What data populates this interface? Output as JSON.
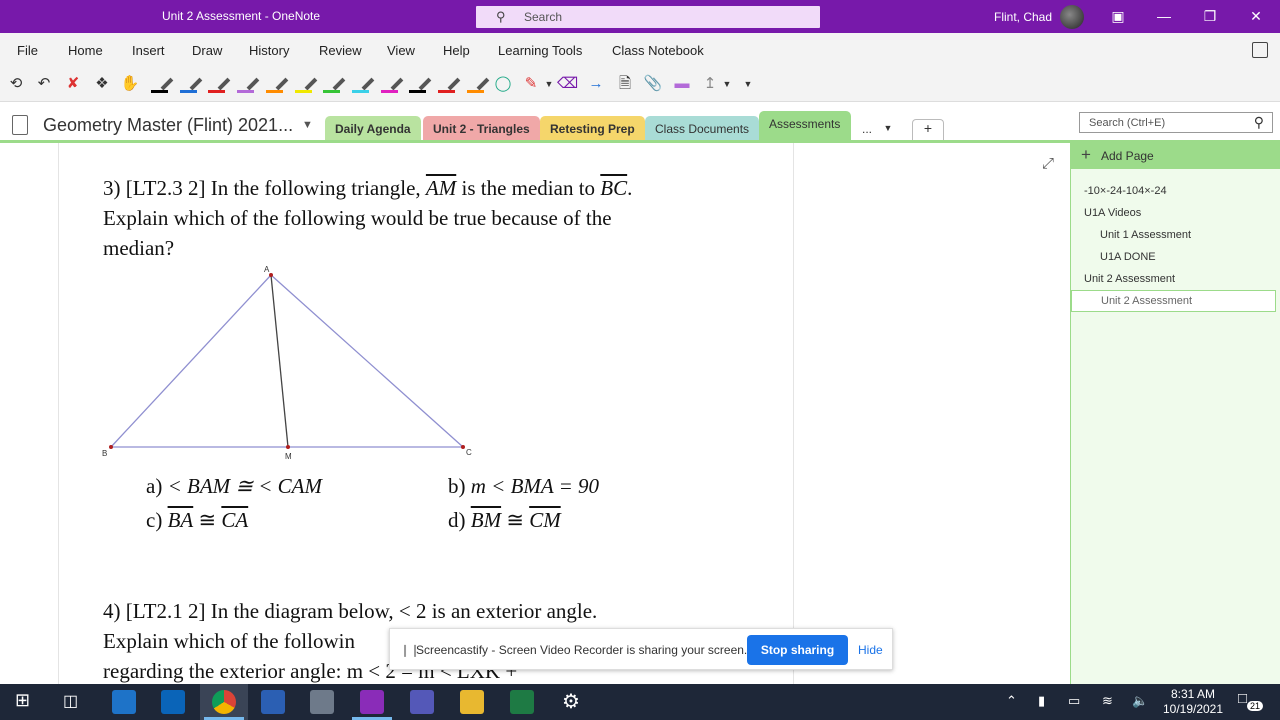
{
  "window": {
    "title": "Unit 2 Assessment  -  OneNote",
    "search_placeholder": "Search",
    "user": "Flint, Chad"
  },
  "menu": [
    "File",
    "Home",
    "Insert",
    "Draw",
    "History",
    "Review",
    "View",
    "Help",
    "Learning Tools",
    "Class Notebook"
  ],
  "pen_colors": [
    "#000000",
    "#1f6fd6",
    "#e02020",
    "#b36ad8",
    "#ff8c00",
    "#f0e800",
    "#36c436",
    "#3ad0e8",
    "#e020c0",
    "#000000",
    "#e02020",
    "#ff8c00"
  ],
  "notebook": {
    "name": "Geometry Master (Flint) 2021...",
    "tabs": [
      {
        "label": "Daily Agenda",
        "color": "#b9e3a0"
      },
      {
        "label": "Unit 2 - Triangles",
        "color": "#f0a8a8"
      },
      {
        "label": "Retesting Prep",
        "color": "#f5d66b"
      },
      {
        "label": "Class Documents",
        "color": "#a9dcd6"
      },
      {
        "label": "Assessments",
        "color": "#9cdb8a"
      }
    ],
    "more": "...",
    "add": "+",
    "search_placeholder": "Search (Ctrl+E)"
  },
  "question3": {
    "line1_pre": "3) [LT2.3 2] In the following triangle, ",
    "seg_am": "AM",
    "line1_mid": " is the median to ",
    "seg_bc": "BC",
    "line1_end": ".",
    "line2": "Explain which of the following would be true because of the",
    "line3": "median?",
    "vertex_labels": {
      "a": "A",
      "b": "B",
      "c": "C",
      "m": "M"
    },
    "choices": {
      "a_label": "a) ",
      "a_expr": "< BAM ≅ < CAM",
      "b_label": "b) ",
      "b_expr": "m < BMA = 90",
      "c_label": "c) ",
      "c_left": "BA",
      "c_rel": " ≅ ",
      "c_right": "CA",
      "d_label": "d) ",
      "d_left": "BM",
      "d_rel": " ≅ ",
      "d_right": "CM"
    }
  },
  "question4": {
    "line1": "4) [LT2.1 2] In the diagram below, < 2 is an exterior angle.",
    "line2": "Explain which of the followin",
    "line3": "regarding the exterior angle:  m < 2 = m < LXK + "
  },
  "sharing": {
    "message": "Screencastify - Screen Video Recorder is sharing your screen.",
    "stop": "Stop sharing",
    "hide": "Hide"
  },
  "pages": {
    "add_page": "Add Page",
    "items": [
      {
        "label": "-10×-24-104×-24",
        "indent": 0
      },
      {
        "label": "U1A Videos",
        "indent": 0
      },
      {
        "label": "Unit 1 Assessment",
        "indent": 1
      },
      {
        "label": "U1A DONE",
        "indent": 1
      },
      {
        "label": "Unit 2 Assessment",
        "indent": 0
      },
      {
        "label": "Unit 2 Assessment",
        "indent": 1,
        "selected": true
      }
    ]
  },
  "taskbar": {
    "time": "8:31 AM",
    "date": "10/19/2021",
    "notifications": "21"
  }
}
